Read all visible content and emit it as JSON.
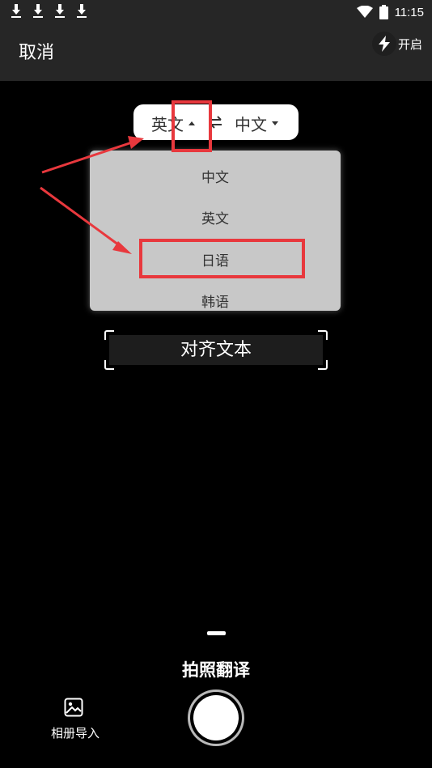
{
  "status_bar": {
    "time": "11:15"
  },
  "header": {
    "cancel_label": "取消",
    "flash_label": "开启"
  },
  "language_bar": {
    "source": "英文",
    "target": "中文"
  },
  "dropdown": {
    "items": [
      "中文",
      "英文",
      "日语",
      "韩语"
    ]
  },
  "viewfinder": {
    "align_hint": "对齐文本"
  },
  "bottom": {
    "mode_title": "拍照翻译",
    "album_label": "相册导入"
  },
  "colors": {
    "annotation": "#e8383d",
    "dropdown_bg": "#c8c8c8",
    "bar_bg": "#262626"
  }
}
